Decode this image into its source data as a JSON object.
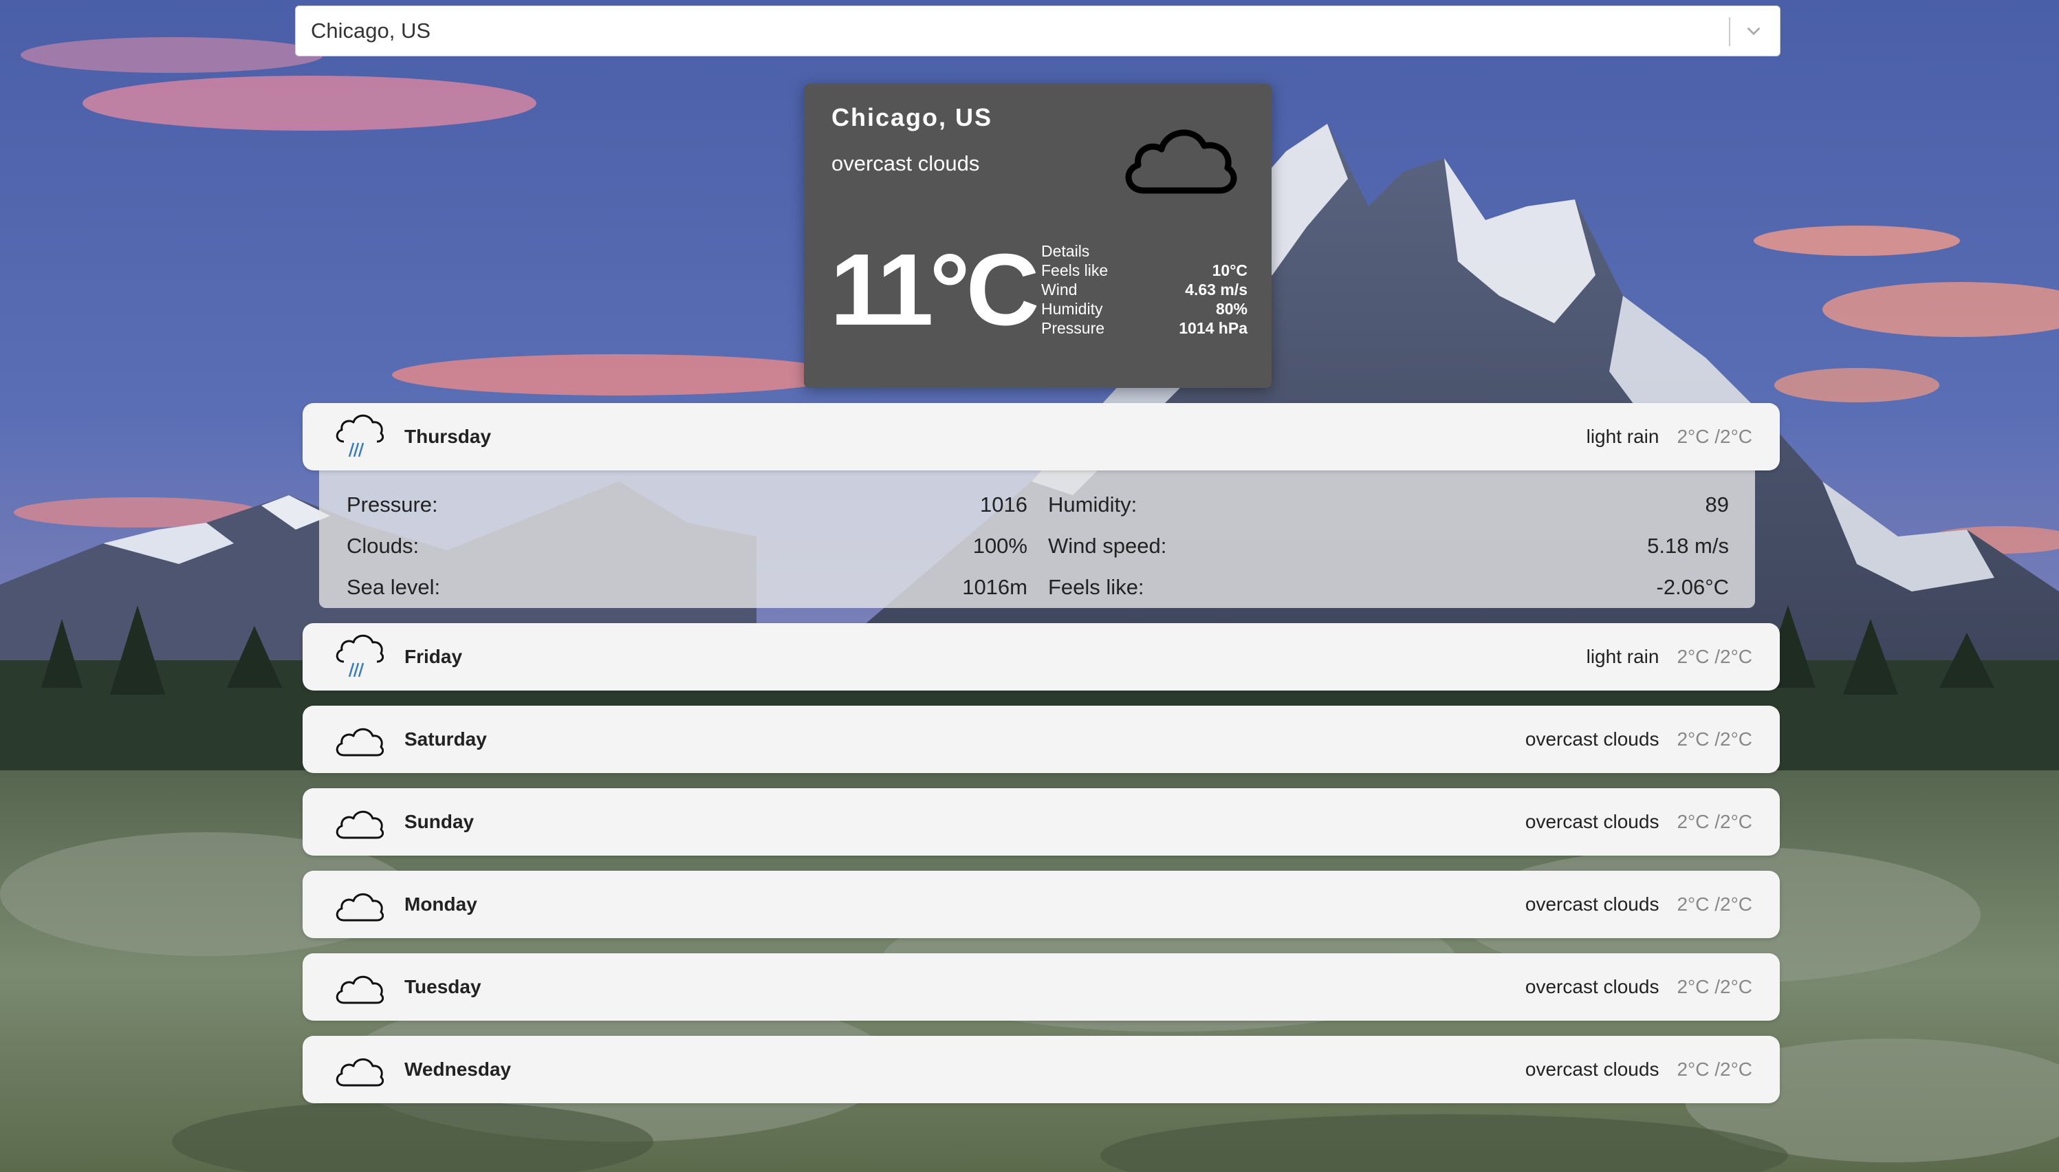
{
  "search": {
    "value": "Chicago, US"
  },
  "current": {
    "city": "Chicago, US",
    "description": "overcast clouds",
    "temperature": "11°C",
    "details_title": "Details",
    "details": [
      {
        "label": "Feels like",
        "value": "10°C"
      },
      {
        "label": "Wind",
        "value": "4.63 m/s"
      },
      {
        "label": "Humidity",
        "value": "80%"
      },
      {
        "label": "Pressure",
        "value": "1014 hPa"
      }
    ],
    "icon": "cloud-icon"
  },
  "forecast": [
    {
      "day": "Thursday",
      "condition": "light rain",
      "range": "2°C /2°C",
      "icon": "rain-cloud-icon"
    },
    {
      "day": "Friday",
      "condition": "light rain",
      "range": "2°C /2°C",
      "icon": "rain-cloud-icon"
    },
    {
      "day": "Saturday",
      "condition": "overcast clouds",
      "range": "2°C /2°C",
      "icon": "cloud-icon"
    },
    {
      "day": "Sunday",
      "condition": "overcast clouds",
      "range": "2°C /2°C",
      "icon": "cloud-icon"
    },
    {
      "day": "Monday",
      "condition": "overcast clouds",
      "range": "2°C /2°C",
      "icon": "cloud-icon"
    },
    {
      "day": "Tuesday",
      "condition": "overcast clouds",
      "range": "2°C /2°C",
      "icon": "cloud-icon"
    },
    {
      "day": "Wednesday",
      "condition": "overcast clouds",
      "range": "2°C /2°C",
      "icon": "cloud-icon"
    }
  ],
  "expanded": {
    "left": [
      {
        "label": "Pressure:",
        "value": "1016"
      },
      {
        "label": "Clouds:",
        "value": "100%"
      },
      {
        "label": "Sea level:",
        "value": "1016m"
      }
    ],
    "right": [
      {
        "label": "Humidity:",
        "value": "89"
      },
      {
        "label": "Wind speed:",
        "value": "5.18 m/s"
      },
      {
        "label": "Feels like:",
        "value": "-2.06°C"
      }
    ]
  },
  "colors": {
    "card_bg": "#555555",
    "row_bg": "#f4f4f4",
    "rain_accent": "#3a7bbf"
  }
}
